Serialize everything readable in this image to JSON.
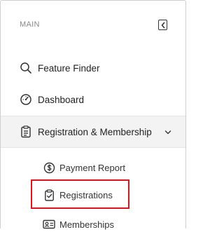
{
  "sidebar": {
    "section_label": "MAIN",
    "items": [
      {
        "label": "Feature Finder",
        "icon": "search-icon"
      },
      {
        "label": "Dashboard",
        "icon": "dashboard-gauge-icon"
      },
      {
        "label": "Registration & Membership",
        "icon": "clipboard-list-icon",
        "expanded": true
      }
    ],
    "sub_items": [
      {
        "label": "Payment Report",
        "icon": "dollar-circle-icon"
      },
      {
        "label": "Registrations",
        "icon": "clipboard-check-icon",
        "highlighted": true
      },
      {
        "label": "Memberships",
        "icon": "id-card-icon"
      }
    ]
  },
  "colors": {
    "highlight_border": "#e0131a",
    "active_background": "#f3f3f3",
    "section_label": "#8a8a8a"
  }
}
